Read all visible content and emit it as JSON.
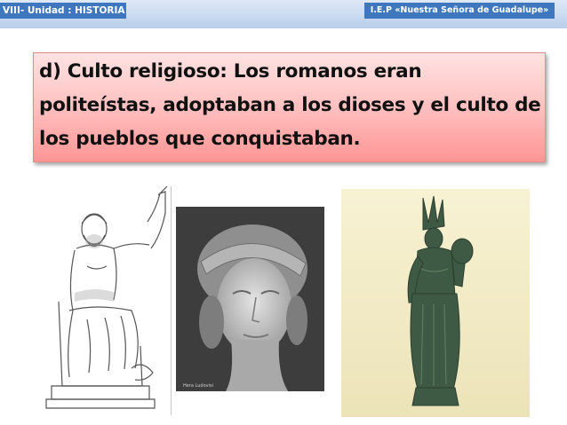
{
  "header": {
    "left_label": "VIII- Unidad : HISTORIA",
    "right_label": "I.E.P «Nuestra Señora de Guadalupe»"
  },
  "slide": {
    "title": "d) Culto religioso: Los romanos eran politeístas, adoptaban a los dioses y el culto de los pueblos que conquistaban."
  },
  "images": [
    {
      "name": "jupiter-statue-drawing"
    },
    {
      "name": "goddess-bust-photo"
    },
    {
      "name": "bronze-goddess-statue"
    }
  ],
  "colors": {
    "header_bar": "#c8d9f0",
    "header_label_bg": "#3e77bd",
    "title_box_top": "#ffe2e2",
    "title_box_bottom": "#ff9595"
  }
}
